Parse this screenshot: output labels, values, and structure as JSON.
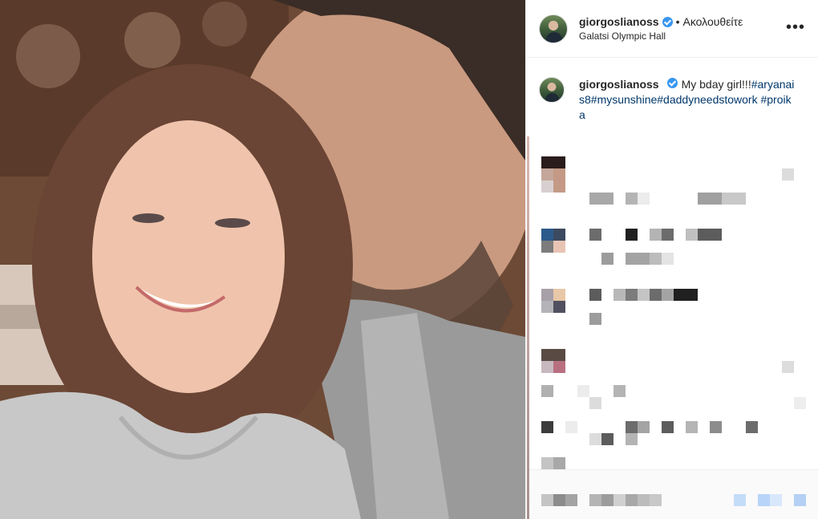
{
  "post": {
    "username": "giorgoslianoss",
    "dot": "•",
    "follow_label": "Ακολουθείτε",
    "location": "Galatsi Olympic Hall",
    "more_label": "•••"
  },
  "caption": {
    "username": "giorgoslianoss",
    "text": "My bday girl!!!",
    "hashtags": "#aryanais8#mysunshine#daddyneedstowork #proika"
  },
  "icons": {
    "verified": "verified-badge-icon",
    "more": "more-options-icon"
  },
  "colors": {
    "verified": "#3897f0",
    "hashtag": "#00376b"
  }
}
